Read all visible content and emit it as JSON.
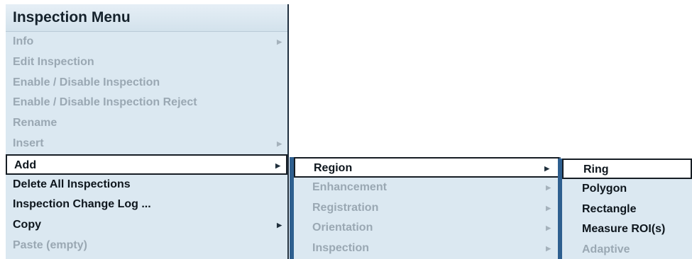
{
  "main_menu": {
    "title": "Inspection Menu",
    "items": [
      {
        "label": "Info",
        "state": "disabled",
        "submenu": true
      },
      {
        "label": "Edit Inspection",
        "state": "disabled",
        "submenu": false
      },
      {
        "label": "Enable / Disable Inspection",
        "state": "disabled",
        "submenu": false
      },
      {
        "label": "Enable / Disable Inspection Reject",
        "state": "disabled",
        "submenu": false
      },
      {
        "label": "Rename",
        "state": "disabled",
        "submenu": false
      },
      {
        "label": "Insert",
        "state": "disabled",
        "submenu": true
      },
      {
        "label": "Add",
        "state": "selected",
        "submenu": true
      },
      {
        "label": "Delete All Inspections",
        "state": "enabled",
        "submenu": false
      },
      {
        "label": "Inspection Change Log ...",
        "state": "enabled",
        "submenu": false
      },
      {
        "label": "Copy",
        "state": "enabled",
        "submenu": true
      },
      {
        "label": "Paste (empty)",
        "state": "disabled",
        "submenu": false
      }
    ]
  },
  "add_submenu": {
    "items": [
      {
        "label": "Region",
        "state": "selected",
        "submenu": true
      },
      {
        "label": "Enhancement",
        "state": "disabled",
        "submenu": true
      },
      {
        "label": "Registration",
        "state": "disabled",
        "submenu": true
      },
      {
        "label": "Orientation",
        "state": "disabled",
        "submenu": true
      },
      {
        "label": "Inspection",
        "state": "disabled",
        "submenu": true
      }
    ]
  },
  "region_submenu": {
    "items": [
      {
        "label": "Ring",
        "state": "selected",
        "submenu": false
      },
      {
        "label": "Polygon",
        "state": "enabled",
        "submenu": false
      },
      {
        "label": "Rectangle",
        "state": "enabled",
        "submenu": false
      },
      {
        "label": "Measure ROI(s)",
        "state": "enabled",
        "submenu": false
      },
      {
        "label": "Adaptive",
        "state": "disabled",
        "submenu": false
      }
    ]
  },
  "icons": {
    "submenu_arrow": "arrow-right-icon"
  },
  "colors": {
    "menu_bg": "#dbe8f1",
    "disabled_text": "#9aa8b3",
    "enabled_text": "#0e161d",
    "selected_bg": "#ffffff",
    "accent_border": "#2e5f8f"
  }
}
